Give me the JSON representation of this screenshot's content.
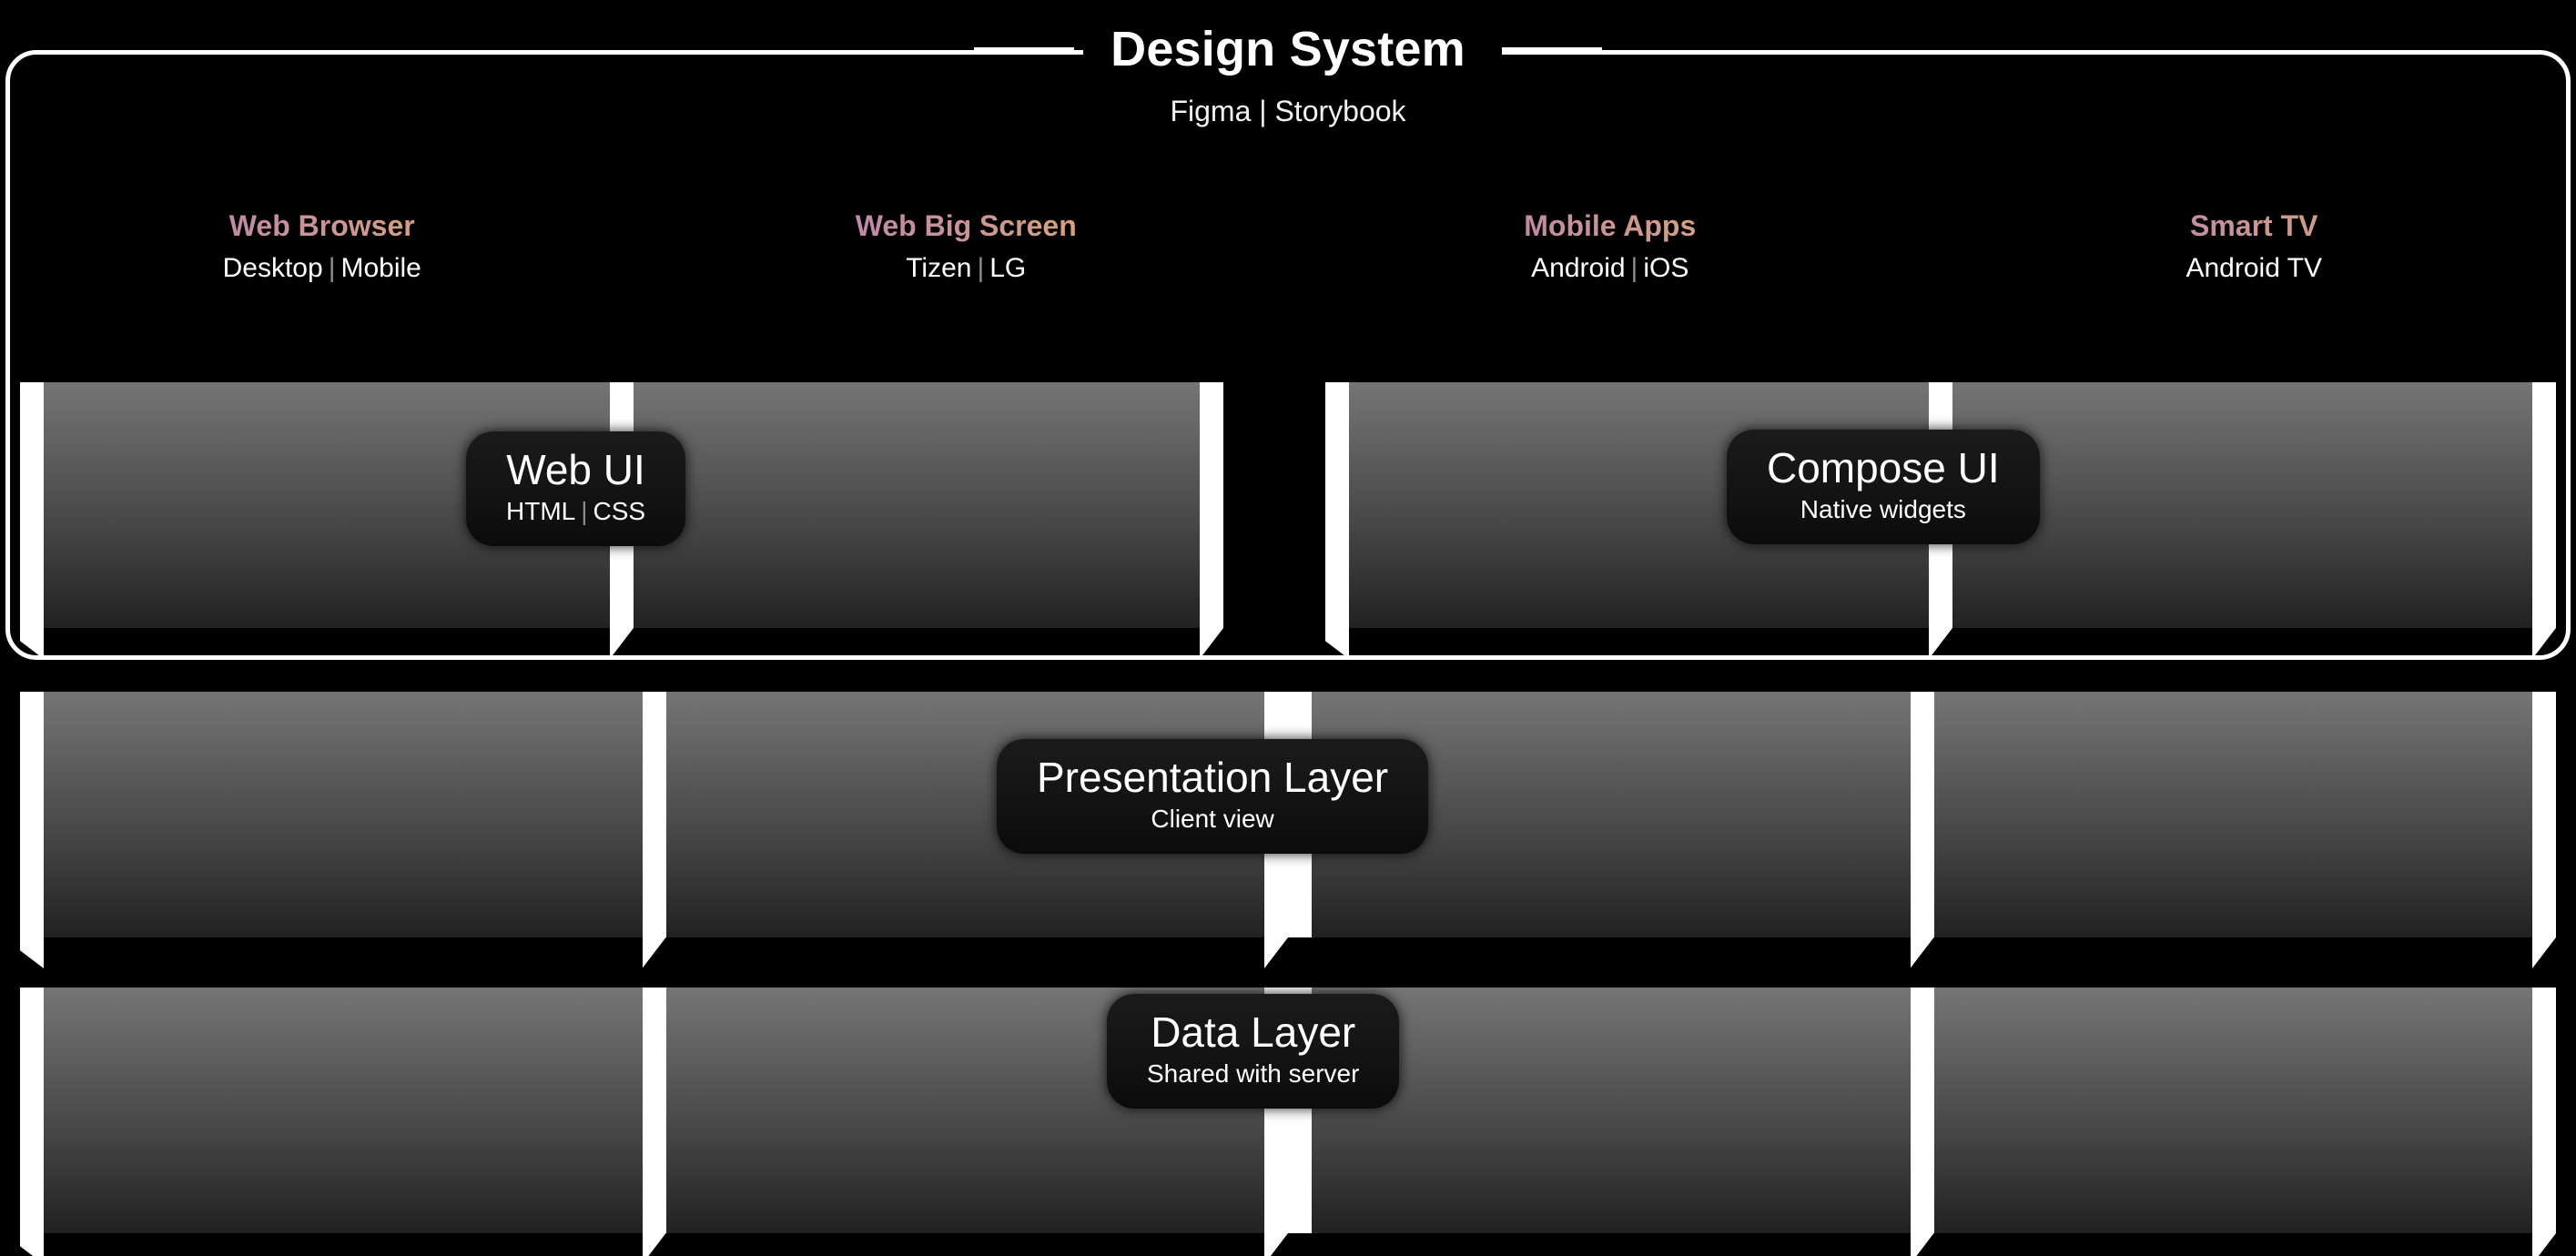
{
  "diagram": {
    "title": "Design System",
    "subtitle": "Figma | Storybook",
    "background_color": "#000000",
    "accent_gradient_start": "#b07cc0",
    "accent_gradient_end": "#e2ac6a",
    "band_gradient_top": "#757575",
    "band_gradient_bottom": "#212121",
    "pill_color": "#121212",
    "outline_color": "#ffffff"
  },
  "platforms": [
    {
      "name": "Web Browser",
      "targets": "Desktop | Mobile",
      "target_left": "Desktop",
      "target_right": "Mobile"
    },
    {
      "name": "Web Big Screen",
      "targets": "Tizen | LG",
      "target_left": "Tizen",
      "target_right": "LG"
    },
    {
      "name": "Mobile Apps",
      "targets": "Android | iOS",
      "target_left": "Android",
      "target_right": "iOS"
    },
    {
      "name": "Smart TV",
      "targets": "Android TV",
      "target_left": "Android TV",
      "target_right": ""
    }
  ],
  "layers": [
    {
      "id": "ui",
      "pills": [
        {
          "title": "Web UI",
          "sub_left": "HTML",
          "sub_right": "CSS",
          "sub": "HTML | CSS"
        },
        {
          "title": "Compose UI",
          "sub_left": "Native widgets",
          "sub_right": "",
          "sub": "Native widgets"
        }
      ]
    },
    {
      "id": "presentation",
      "pills": [
        {
          "title": "Presentation Layer",
          "sub_left": "Client view",
          "sub_right": "",
          "sub": "Client view"
        }
      ]
    },
    {
      "id": "data",
      "pills": [
        {
          "title": "Data Layer",
          "sub_left": "Shared with server",
          "sub_right": "",
          "sub": "Shared with server"
        }
      ]
    }
  ]
}
